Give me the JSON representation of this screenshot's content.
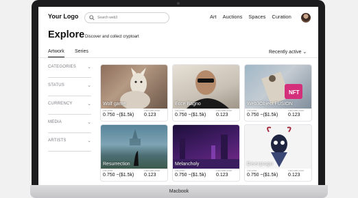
{
  "nav": {
    "logo": "Your Logo",
    "search_placeholder": "Search web3",
    "links": [
      "Art",
      "Auctions",
      "Spaces",
      "Curation"
    ]
  },
  "hero": {
    "title": "Explore",
    "subtitle": "Discover and collect cryptoart"
  },
  "tabs": [
    "Artwork",
    "Series"
  ],
  "sort_label": "Recently active ⌄",
  "filters": [
    "CATEGORIES",
    "STATUS",
    "CURRENCY",
    "MEDIA",
    "ARTISTS"
  ],
  "card_labels": {
    "list_price": "List price",
    "last_sale": "Last sale price"
  },
  "cards": [
    {
      "name": "Wolf game",
      "price": "0.750 ~($1.5k)",
      "last": "0.123"
    },
    {
      "name": "Ecce Bagno",
      "price": "0.750 ~($1.5k)",
      "last": "0.123"
    },
    {
      "name": "Web3Object FUSION",
      "price": "0.750 ~($1.5k)",
      "last": "0.123"
    },
    {
      "name": "Resurrection",
      "price": "0.750 ~($1.5k)",
      "last": "0.123"
    },
    {
      "name": "Melancholy",
      "price": "0.750 ~($1.5k)",
      "last": "0.123"
    },
    {
      "name": "Deerpogo",
      "price": "0.750 ~($1.5k)",
      "last": "0.123"
    }
  ],
  "device_label": "Macbook"
}
